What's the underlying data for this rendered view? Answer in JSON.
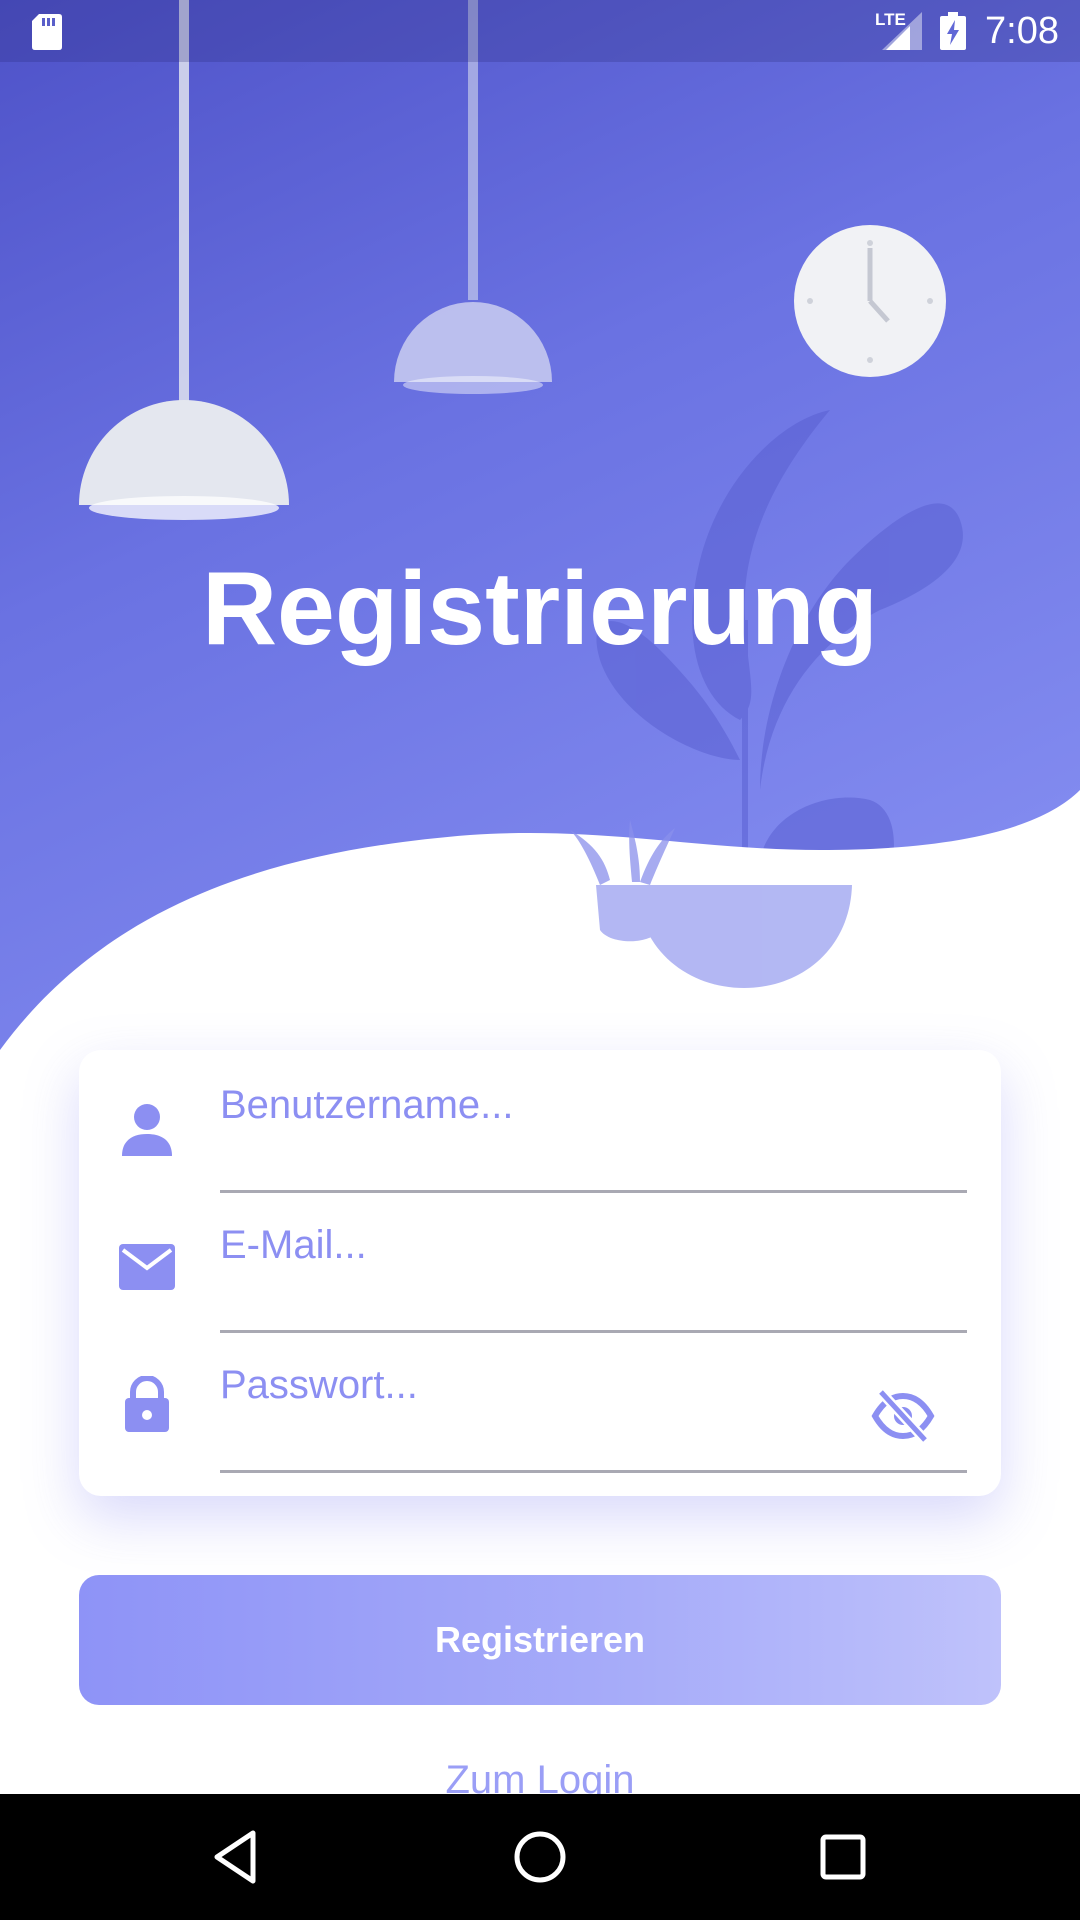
{
  "status_bar": {
    "network": "LTE",
    "time": "7:08"
  },
  "header": {
    "title": "Registrierung"
  },
  "form": {
    "username": {
      "placeholder": "Benutzername...",
      "value": "",
      "icon": "person-icon"
    },
    "email": {
      "placeholder": "E-Mail...",
      "value": "",
      "icon": "mail-icon"
    },
    "password": {
      "placeholder": "Passwort...",
      "value": "",
      "icon": "lock-icon",
      "toggle_icon": "visibility-off-icon"
    }
  },
  "actions": {
    "register_label": "Registrieren",
    "login_link": "Zum Login"
  },
  "colors": {
    "accent": "#8c8ff2",
    "header_start": "#4e52c8",
    "header_end": "#8a93f4",
    "button_start": "#8e93f7",
    "button_end": "#bfc2fb"
  }
}
